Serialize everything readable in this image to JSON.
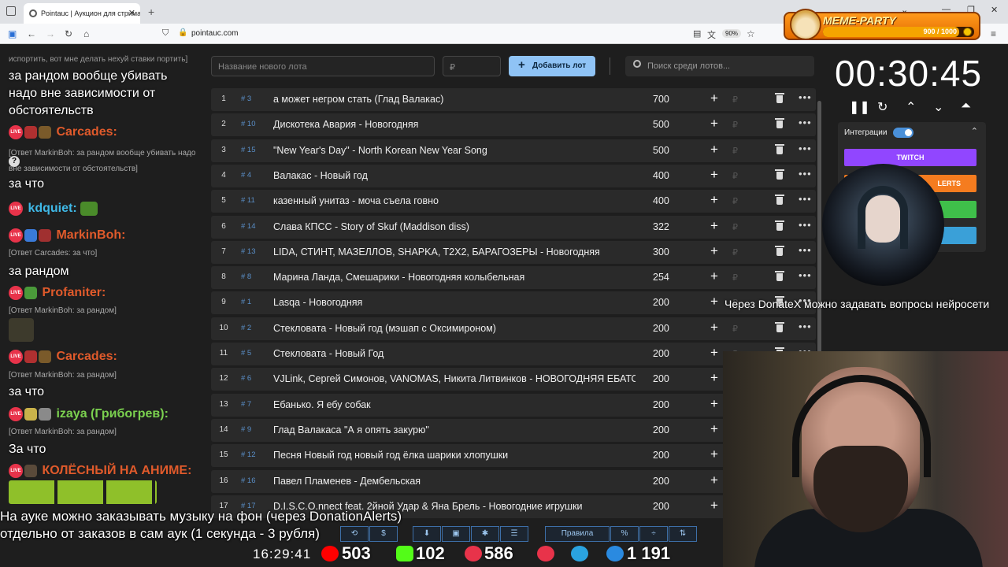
{
  "browser": {
    "tab_title": "Pointauc | Аукцион для стрима",
    "url": "pointauc.com",
    "zoom": "90%"
  },
  "meme_party": {
    "title": "MEME-PARTY",
    "count": "900 / 1000",
    "progress": 0.9
  },
  "chat": {
    "top_partial": "испортить, вот мне делать нехуй ставки портить]",
    "messages": [
      {
        "text": "за рандом вообще убивать надо вне зависимости от обстоятельств"
      },
      {
        "user": "Carcades:",
        "color": "#e05a2b",
        "reply": "[Ответ MarkinBoh: за рандом вообще убивать надо вне зависимости от обстоятельств]",
        "text": "за что"
      },
      {
        "user": "kdquiet:",
        "color": "#3fb8e6"
      },
      {
        "user": "MarkinBoh:",
        "color": "#e05a2b",
        "reply": "[Ответ Carcades: за что]",
        "text": "за рандом"
      },
      {
        "user": "Profaniter:",
        "color": "#e05a2b",
        "reply": "[Ответ MarkinBoh: за рандом]"
      },
      {
        "user": "Carcades:",
        "color": "#e05a2b",
        "reply": "[Ответ MarkinBoh: за рандом]",
        "text": "за что"
      },
      {
        "user": "izaya (Грибогрев):",
        "color": "#7bd14f",
        "reply": "[Ответ MarkinBoh: за рандом]",
        "text": "За что"
      },
      {
        "user": "КОЛЁСНЫЙ НА АНИМЕ:",
        "color": "#e05a2b"
      }
    ]
  },
  "controls": {
    "new_lot_placeholder": "Название нового лота",
    "amount_placeholder": "₽",
    "add_lot": "Добавить лот",
    "search_placeholder": "Поиск среди лотов..."
  },
  "lots": [
    {
      "n": "1",
      "id": "# 3",
      "name": "а может негром стать (Глад Валакас)",
      "amount": "700"
    },
    {
      "n": "2",
      "id": "# 10",
      "name": "Дискотека Авария - Новогодняя",
      "amount": "500"
    },
    {
      "n": "3",
      "id": "# 15",
      "name": "\"New Year's Day\" - North Korean New Year Song",
      "amount": "500"
    },
    {
      "n": "4",
      "id": "# 4",
      "name": "Валакас - Новый год",
      "amount": "400"
    },
    {
      "n": "5",
      "id": "# 11",
      "name": "казенный унитаз - моча съела говно",
      "amount": "400"
    },
    {
      "n": "6",
      "id": "# 14",
      "name": "Слава КПСС - Story of Skuf (Maddison diss)",
      "amount": "322"
    },
    {
      "n": "7",
      "id": "# 13",
      "name": "LIDA, СТИНТ, МАЗЕЛЛОВ, SHAPKA, T2X2, БАРАГОЗЕРЫ - Новогодняя",
      "amount": "300"
    },
    {
      "n": "8",
      "id": "# 8",
      "name": "Марина Ланда, Смешарики - Новогодняя колыбельная",
      "amount": "254"
    },
    {
      "n": "9",
      "id": "# 1",
      "name": "Lasqa - Новогодняя",
      "amount": "200"
    },
    {
      "n": "10",
      "id": "# 2",
      "name": "Стекловата - Новый год (мэшап с Оксимироном)",
      "amount": "200"
    },
    {
      "n": "11",
      "id": "# 5",
      "name": "Стекловата - Новый Год",
      "amount": "200"
    },
    {
      "n": "12",
      "id": "# 6",
      "name": "VJLink, Сергей Симонов, VANOMAS, Никита Литвинков - НОВОГОДНЯЯ ЕБАТОРИЯ",
      "amount": "200"
    },
    {
      "n": "13",
      "id": "# 7",
      "name": "Ебанько. Я ебу собак",
      "amount": "200"
    },
    {
      "n": "14",
      "id": "# 9",
      "name": "Глад Валакаса \"А я опять закурю\"",
      "amount": "200"
    },
    {
      "n": "15",
      "id": "# 12",
      "name": "Песня Новый год новый год ёлка шарики хлопушки",
      "amount": "200"
    },
    {
      "n": "16",
      "id": "# 16",
      "name": "Павел Пламенев - Дембельская",
      "amount": "200"
    },
    {
      "n": "17",
      "id": "# 17",
      "name": "D.I.S.C.O.nnect feat. 2йной Удар & Яна Брель - Новогодние игрушки",
      "amount": "200"
    }
  ],
  "toolbar": {
    "rules": "Правила",
    "percent": "%"
  },
  "timer": {
    "time": "00:30:45"
  },
  "integrations": {
    "label": "Интеграции",
    "twitch": "TWITCH",
    "donationalerts": "LERTS"
  },
  "overlay": {
    "question": "Через DonateX можно задавать вопросы нейросети",
    "subtitle_line1": "На ауке можно заказывать музыку на фон (через DonationAlerts)",
    "subtitle_line2": "отдельно от заказов в сам аук (1 секунда - 3 рубля)"
  },
  "stats": {
    "clock": "16:29:41",
    "youtube": "503",
    "kick": "102",
    "live": "586",
    "total": "1 191"
  },
  "colors": {
    "accent": "#8fc3f5",
    "twitch": "#9146ff",
    "donationalerts": "#f57c1f",
    "green": "#3fbf4a",
    "blue": "#3aa0d8"
  }
}
